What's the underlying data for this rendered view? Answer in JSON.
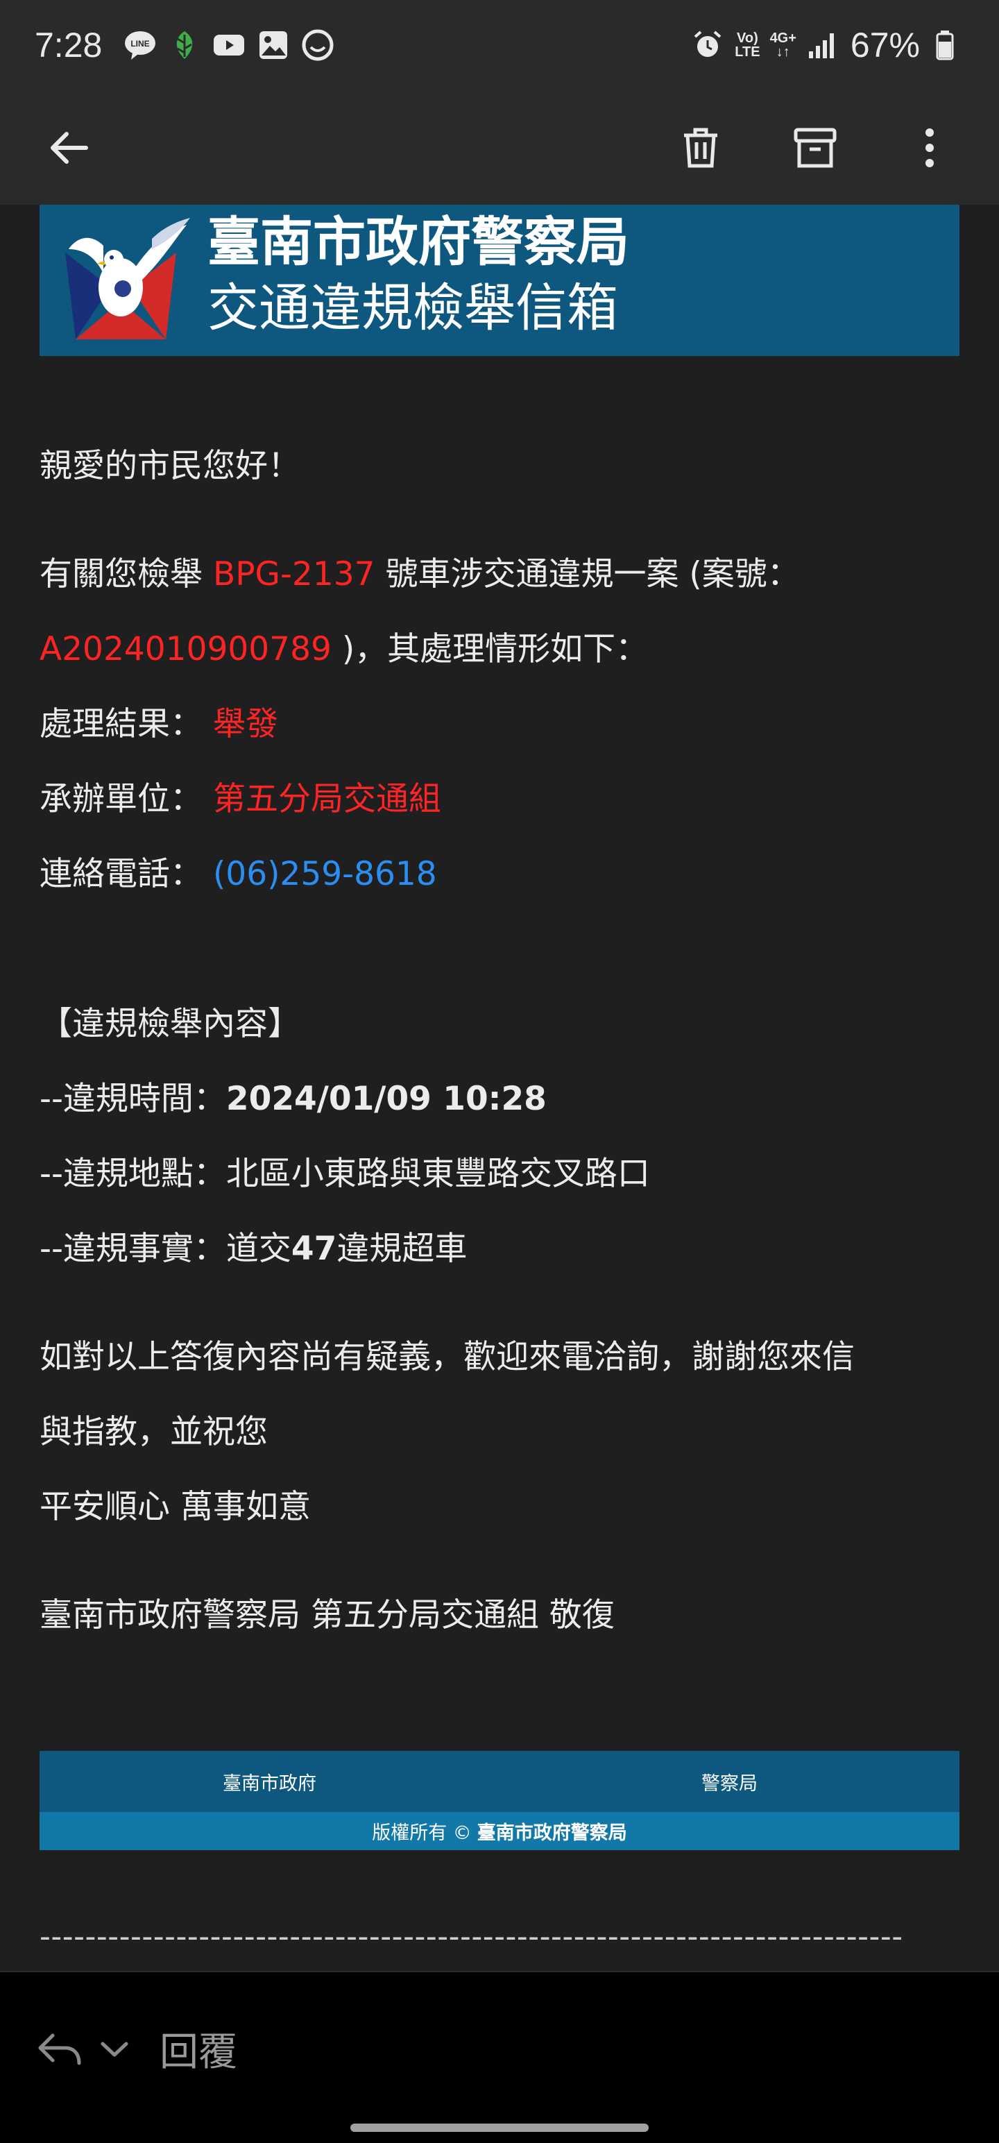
{
  "status_bar": {
    "time": "7:28",
    "notification_icons": [
      "line-icon",
      "leaf-app-icon",
      "youtube-icon",
      "gallery-icon",
      "messenger-icon"
    ],
    "right_icons": [
      "alarm-icon",
      "volte-icon",
      "4g-signal-icon",
      "signal-icon"
    ],
    "volte_top": "Vo)",
    "volte_bottom": "LTE",
    "net_top": "4G+",
    "net_bottom": "↓↑",
    "battery": "67%"
  },
  "toolbar": {
    "back_icon": "arrow-left-icon",
    "delete_icon": "trash-icon",
    "archive_icon": "archive-icon",
    "more_icon": "more-vertical-icon"
  },
  "banner": {
    "title": "臺南市政府警察局",
    "subtitle": "交通違規檢舉信箱",
    "bg_color": "#0e5880"
  },
  "email": {
    "greeting": "親愛的市民您好！",
    "intro_1": "有關您檢舉 ",
    "plate": "BPG-2137",
    "intro_2": " 號車涉交通違規一案 (案號：",
    "case_no": "A2024010900789",
    "intro_3": " )，其處理情形如下：",
    "result_label": "處理結果：",
    "result_value": "舉發",
    "unit_label": "承辦單位：",
    "unit_value": "第五分局交通組",
    "phone_label": "連絡電話：",
    "phone_value": "(06)259-8618",
    "section_title": "【違規檢舉內容】",
    "time_label": "--違規時間：",
    "time_value": "2024/01/09 10:28",
    "place_label": "--違規地點：",
    "place_value": "北區小東路與東豐路交叉路口",
    "fact_label": "--違規事實：",
    "fact_value_1": "道交",
    "fact_value_num": "47",
    "fact_value_2": "違規超車",
    "closing_1": "如對以上答復內容尚有疑義，歡迎來電洽詢，謝謝您來信",
    "closing_2": "與指教，並祝您",
    "closing_3": "平安順心 萬事如意",
    "signature": "臺南市政府警察局 第五分局交通組 敬復",
    "highlight_red": "#ff2424",
    "highlight_blue": "#2b8ef2"
  },
  "footer": {
    "link_1": "臺南市政府",
    "link_2": "警察局",
    "copyright_prefix": "版權所有 ©",
    "copyright_owner": "臺南市政府警察局",
    "dashes": "----------------------------------------------------------------------------"
  },
  "bottom_bar": {
    "reply_icon": "reply-icon",
    "dropdown_icon": "chevron-down-icon",
    "reply_label": "回覆"
  }
}
